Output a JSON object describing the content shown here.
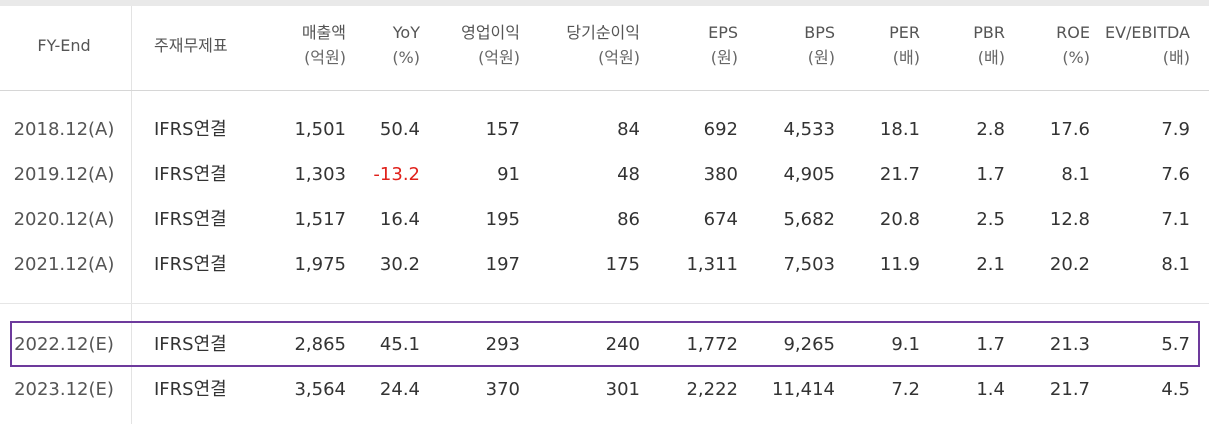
{
  "header": {
    "fy_end": "FY-End",
    "basis": "주재무제표",
    "columns": [
      {
        "top": "매출액",
        "sub": "(억원)"
      },
      {
        "top": "YoY",
        "sub": "(%)"
      },
      {
        "top": "영업이익",
        "sub": "(억원)"
      },
      {
        "top": "당기순이익",
        "sub": "(억원)"
      },
      {
        "top": "EPS",
        "sub": "(원)"
      },
      {
        "top": "BPS",
        "sub": "(원)"
      },
      {
        "top": "PER",
        "sub": "(배)"
      },
      {
        "top": "PBR",
        "sub": "(배)"
      },
      {
        "top": "ROE",
        "sub": "(%)"
      },
      {
        "top": "EV/EBITDA",
        "sub": "(배)"
      }
    ]
  },
  "rows": [
    {
      "date": "2018.12(A)",
      "basis": "IFRS연결",
      "values": [
        "1,501",
        "50.4",
        "157",
        "84",
        "692",
        "4,533",
        "18.1",
        "2.8",
        "17.6",
        "7.9"
      ]
    },
    {
      "date": "2019.12(A)",
      "basis": "IFRS연결",
      "values": [
        "1,303",
        "-13.2",
        "91",
        "48",
        "380",
        "4,905",
        "21.7",
        "1.7",
        "8.1",
        "7.6"
      ]
    },
    {
      "date": "2020.12(A)",
      "basis": "IFRS연결",
      "values": [
        "1,517",
        "16.4",
        "195",
        "86",
        "674",
        "5,682",
        "20.8",
        "2.5",
        "12.8",
        "7.1"
      ]
    },
    {
      "date": "2021.12(A)",
      "basis": "IFRS연결",
      "values": [
        "1,975",
        "30.2",
        "197",
        "175",
        "1,311",
        "7,503",
        "11.9",
        "2.1",
        "20.2",
        "8.1"
      ]
    },
    {
      "date": "2022.12(E)",
      "basis": "IFRS연결",
      "values": [
        "2,865",
        "45.1",
        "293",
        "240",
        "1,772",
        "9,265",
        "9.1",
        "1.7",
        "21.3",
        "5.7"
      ]
    },
    {
      "date": "2023.12(E)",
      "basis": "IFRS연결",
      "values": [
        "3,564",
        "24.4",
        "370",
        "301",
        "2,222",
        "11,414",
        "7.2",
        "1.4",
        "21.7",
        "4.5"
      ]
    }
  ],
  "colors": {
    "highlight_border": "#6d3a9c",
    "negative": "#e0211b"
  }
}
